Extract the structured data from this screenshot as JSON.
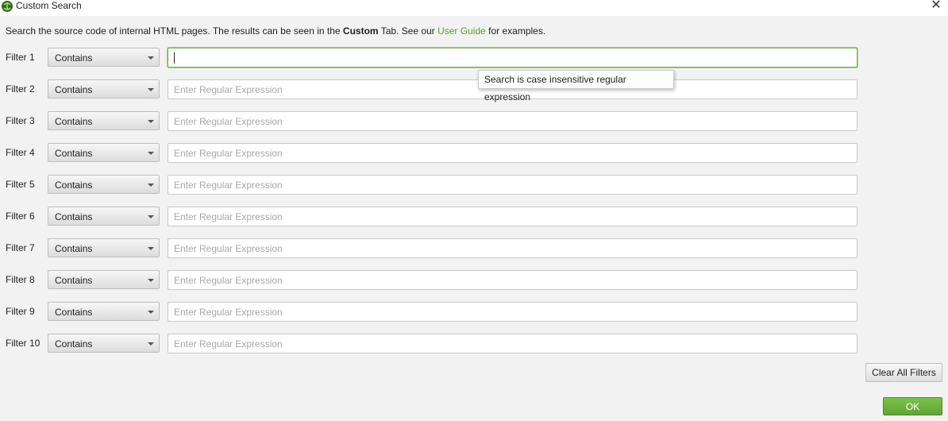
{
  "window": {
    "title": "Custom Search",
    "icon": "spider-logo-icon",
    "close_glyph": "✕"
  },
  "description": {
    "part1": "Search the source code of internal HTML pages. The results can be seen in the ",
    "bold": "Custom",
    "part2": " Tab. See our ",
    "link": "User Guide",
    "part3": " for examples."
  },
  "filters": [
    {
      "label": "Filter 1",
      "mode": "Contains",
      "value": "",
      "placeholder": ""
    },
    {
      "label": "Filter 2",
      "mode": "Contains",
      "value": "",
      "placeholder": "Enter Regular Expression"
    },
    {
      "label": "Filter 3",
      "mode": "Contains",
      "value": "",
      "placeholder": "Enter Regular Expression"
    },
    {
      "label": "Filter 4",
      "mode": "Contains",
      "value": "",
      "placeholder": "Enter Regular Expression"
    },
    {
      "label": "Filter 5",
      "mode": "Contains",
      "value": "",
      "placeholder": "Enter Regular Expression"
    },
    {
      "label": "Filter 6",
      "mode": "Contains",
      "value": "",
      "placeholder": "Enter Regular Expression"
    },
    {
      "label": "Filter 7",
      "mode": "Contains",
      "value": "",
      "placeholder": "Enter Regular Expression"
    },
    {
      "label": "Filter 8",
      "mode": "Contains",
      "value": "",
      "placeholder": "Enter Regular Expression"
    },
    {
      "label": "Filter 9",
      "mode": "Contains",
      "value": "",
      "placeholder": "Enter Regular Expression"
    },
    {
      "label": "Filter 10",
      "mode": "Contains",
      "value": "",
      "placeholder": "Enter Regular Expression"
    }
  ],
  "tooltip": "Search is case insensitive regular expression",
  "buttons": {
    "clear_all": "Clear All Filters",
    "ok": "OK"
  },
  "colors": {
    "accent_green": "#6ab23d",
    "link_green": "#5aa02c",
    "ok_button": "#6fb540"
  }
}
